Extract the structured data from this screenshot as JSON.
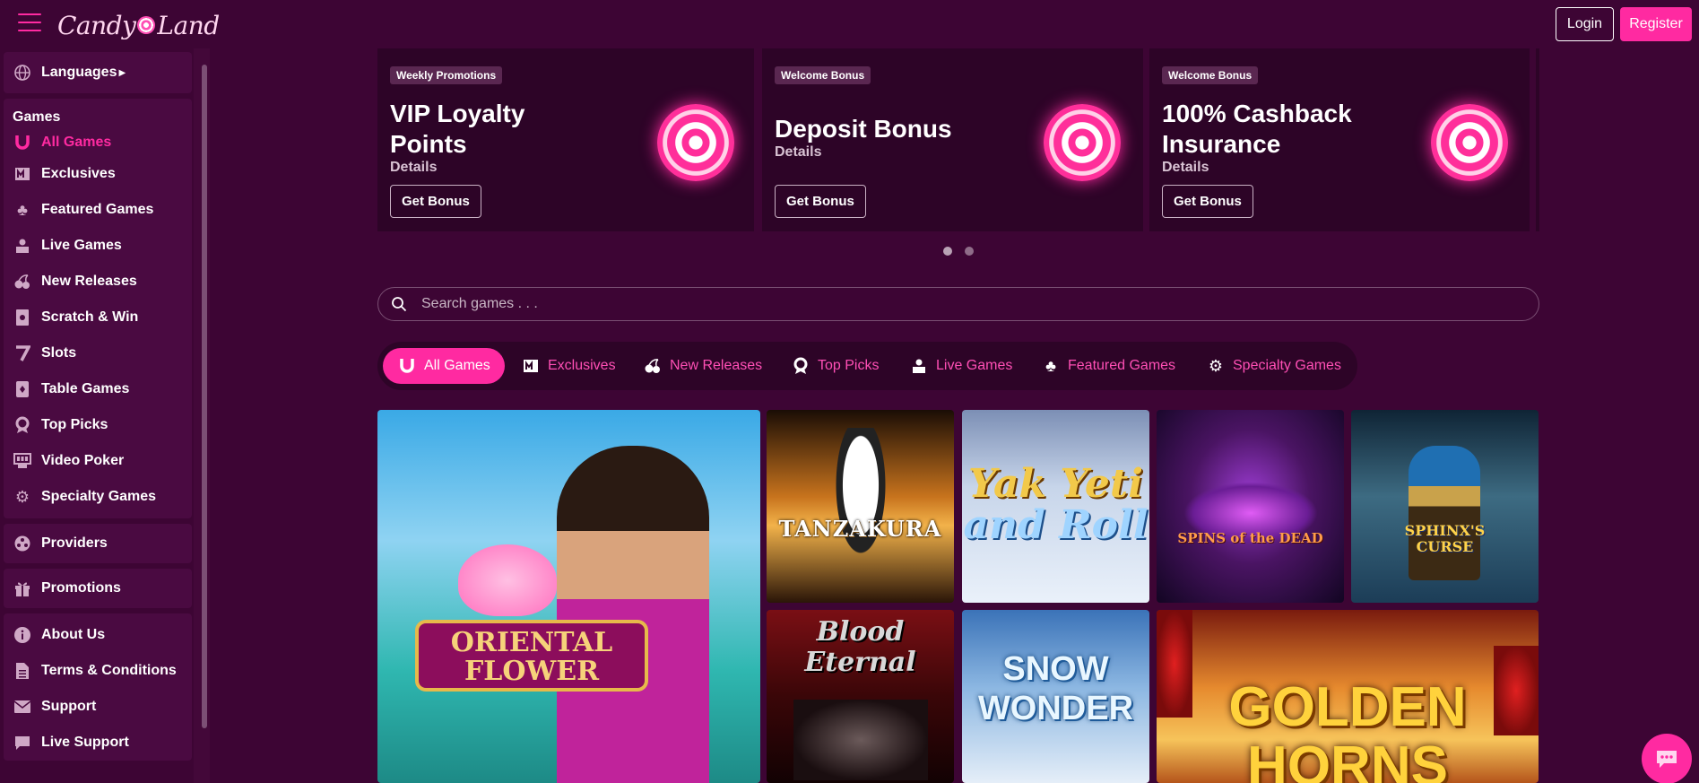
{
  "brand": {
    "name_left": "Candy",
    "name_right": "Land"
  },
  "header": {
    "login_label": "Login",
    "register_label": "Register"
  },
  "sidebar": {
    "languages_label": "Languages",
    "games_heading": "Games",
    "games": [
      {
        "label": "All Games",
        "icon": "horseshoe-icon"
      },
      {
        "label": "Exclusives",
        "icon": "exclusive-icon"
      },
      {
        "label": "Featured Games",
        "icon": "clover-icon"
      },
      {
        "label": "Live Games",
        "icon": "dealer-icon"
      },
      {
        "label": "New Releases",
        "icon": "cherries-icon"
      },
      {
        "label": "Scratch & Win",
        "icon": "scratch-card-icon"
      },
      {
        "label": "Slots",
        "icon": "seven-icon"
      },
      {
        "label": "Table Games",
        "icon": "card-icon"
      },
      {
        "label": "Top Picks",
        "icon": "award-icon"
      },
      {
        "label": "Video Poker",
        "icon": "poker-machine-icon"
      },
      {
        "label": "Specialty Games",
        "icon": "gear-icon"
      }
    ],
    "providers_label": "Providers",
    "promotions_label": "Promotions",
    "footer": [
      {
        "label": "About Us",
        "icon": "info-icon"
      },
      {
        "label": "Terms & Conditions",
        "icon": "document-icon"
      },
      {
        "label": "Support",
        "icon": "mail-icon"
      },
      {
        "label": "Live Support",
        "icon": "chat-icon"
      }
    ]
  },
  "promos": [
    {
      "tag": "Weekly Promotions",
      "title_line1": "VIP Loyalty",
      "title_line2": "Points",
      "details": "Details",
      "button": "Get Bonus"
    },
    {
      "tag": "Welcome Bonus",
      "title_line1": "Deposit Bonus",
      "title_line2": "",
      "details": "Details",
      "button": "Get Bonus"
    },
    {
      "tag": "Welcome Bonus",
      "title_line1": "100% Cashback",
      "title_line2": "Insurance",
      "details": "Details",
      "button": "Get Bonus"
    }
  ],
  "search": {
    "placeholder": "Search games . . ."
  },
  "categories": [
    {
      "label": "All Games",
      "icon": "horseshoe-icon"
    },
    {
      "label": "Exclusives",
      "icon": "exclusive-icon"
    },
    {
      "label": "New Releases",
      "icon": "cherries-icon"
    },
    {
      "label": "Top Picks",
      "icon": "award-icon"
    },
    {
      "label": "Live Games",
      "icon": "dealer-icon"
    },
    {
      "label": "Featured Games",
      "icon": "clover-icon"
    },
    {
      "label": "Specialty Games",
      "icon": "gear-icon"
    }
  ],
  "games": [
    {
      "title_line1": "ORIENTAL",
      "title_line2": "FLOWER"
    },
    {
      "title_line1": "TANZAKURA"
    },
    {
      "title_line1": "Yak Yeti",
      "title_line2": "and Roll"
    },
    {
      "title_line1": "SPINS of the DEAD"
    },
    {
      "title_line1": "SPHINX'S",
      "title_line2": "CURSE"
    },
    {
      "title_line1": "Blood",
      "title_line2": "Eternal"
    },
    {
      "title_line1": "SNOW",
      "title_line2": "WONDER"
    },
    {
      "title_line1": "GOLDEN",
      "title_line2": "HORNS"
    }
  ],
  "colors": {
    "background": "#3d0534",
    "accent": "#ff2aa1",
    "card": "#2d0427"
  }
}
